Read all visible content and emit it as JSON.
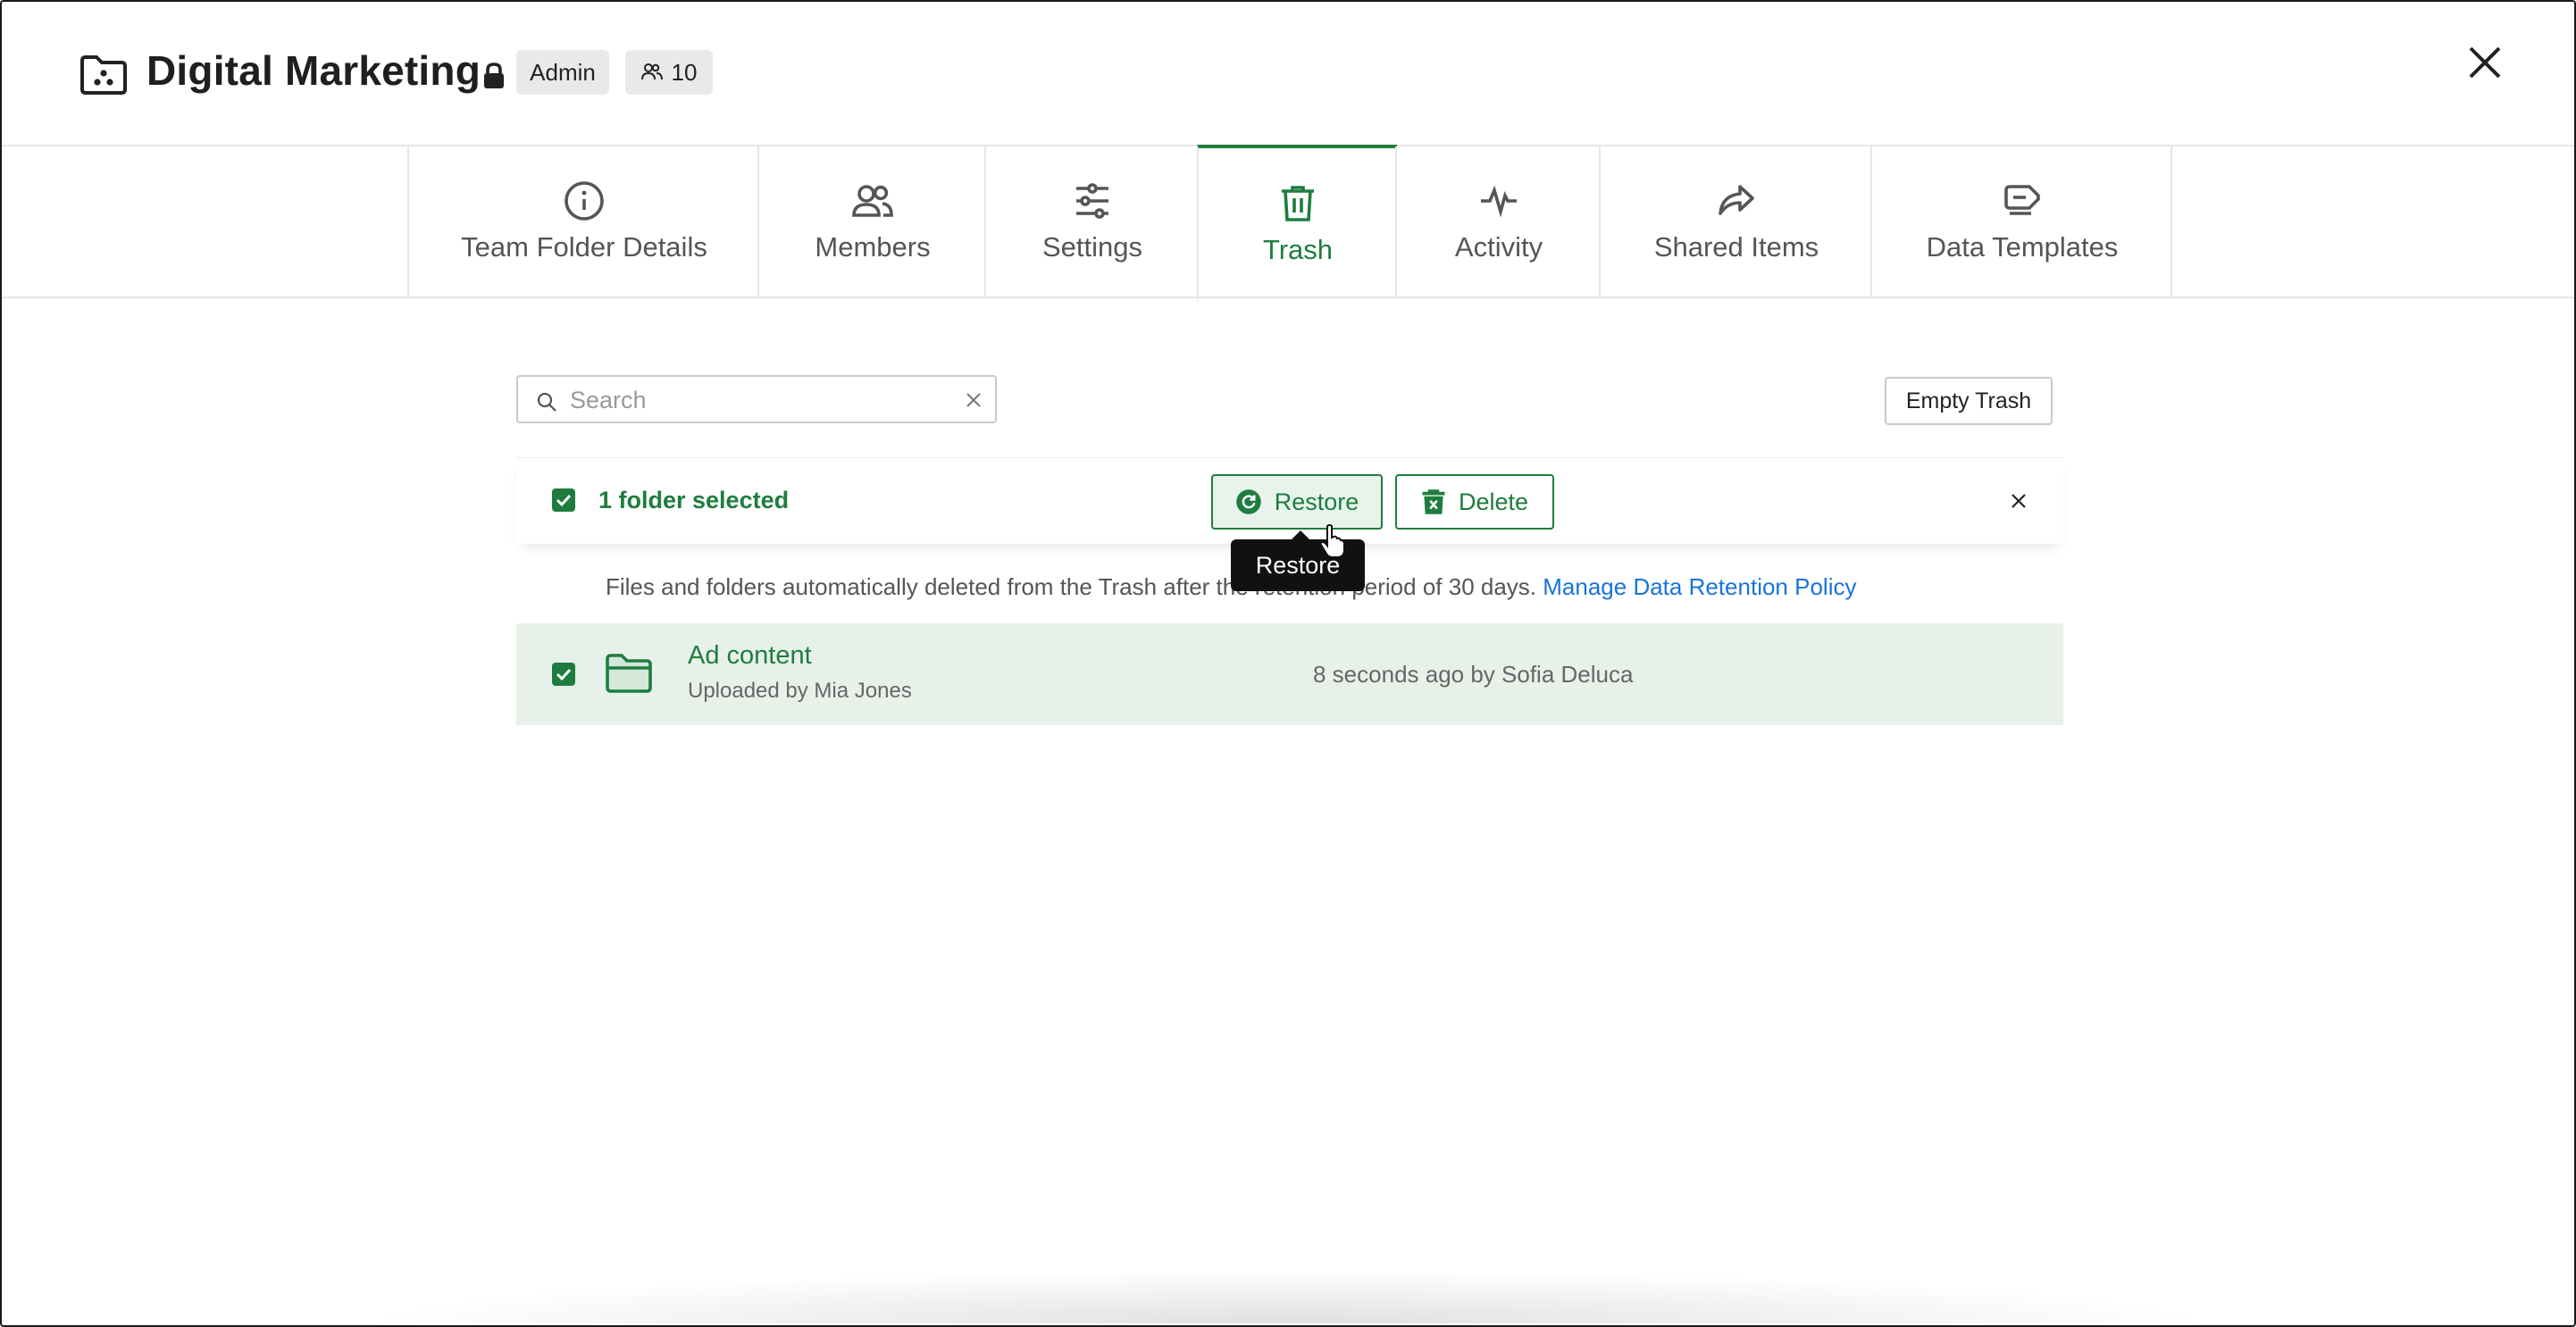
{
  "header": {
    "title": "Digital Marketing",
    "role_badge": "Admin",
    "member_count": "10"
  },
  "tabs": [
    {
      "label": "Team Folder Details",
      "icon": "info-icon"
    },
    {
      "label": "Members",
      "icon": "members-icon"
    },
    {
      "label": "Settings",
      "icon": "sliders-icon"
    },
    {
      "label": "Trash",
      "icon": "trash-icon",
      "active": true
    },
    {
      "label": "Activity",
      "icon": "activity-icon"
    },
    {
      "label": "Shared Items",
      "icon": "share-icon"
    },
    {
      "label": "Data Templates",
      "icon": "tag-icon"
    }
  ],
  "search": {
    "placeholder": "Search",
    "value": ""
  },
  "toolbar": {
    "empty_trash_label": "Empty Trash"
  },
  "selection": {
    "text": "1 folder selected",
    "restore_label": "Restore",
    "delete_label": "Delete",
    "tooltip": "Restore"
  },
  "notice": {
    "text": "Files and folders automatically deleted from the Trash after the retention period of 30 days.",
    "link": "Manage Data Retention Policy"
  },
  "items": [
    {
      "name": "Ad content",
      "uploaded_by": "Uploaded by Mia Jones",
      "deleted": "8 seconds ago by Sofia Deluca",
      "selected": true
    }
  ],
  "colors": {
    "accent": "#1e7d3e",
    "link": "#1a73d9",
    "row_selected": "#e7f1ea"
  }
}
